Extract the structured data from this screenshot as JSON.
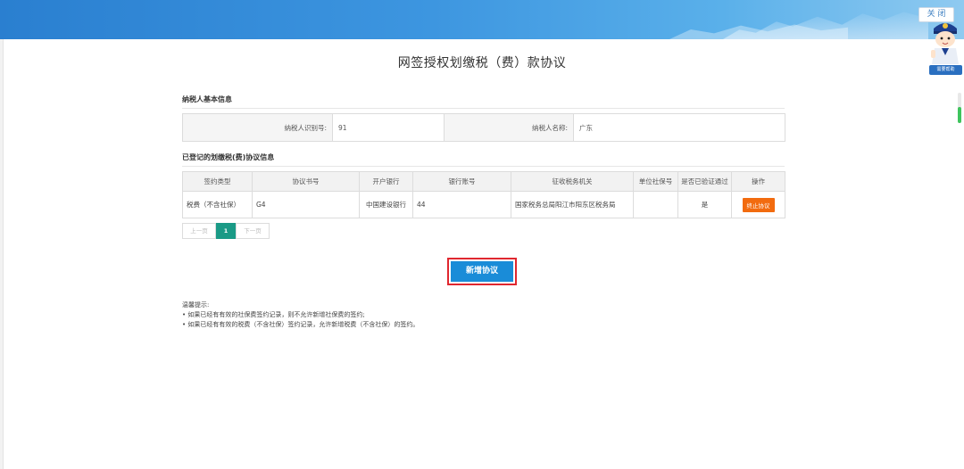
{
  "header": {
    "close_label": "关 闭",
    "mascot_badge": "需要帮助"
  },
  "page": {
    "title": "网签授权划缴税（费）款协议"
  },
  "basic_info": {
    "section_title": "纳税人基本信息",
    "taxpayer_id_label": "纳税人识别号:",
    "taxpayer_id_value": "91",
    "taxpayer_name_label": "纳税人名称:",
    "taxpayer_name_value": "广东"
  },
  "agreements": {
    "section_title": "已登记的划缴税(费)协议信息",
    "columns": [
      "签约类型",
      "协议书号",
      "开户银行",
      "银行账号",
      "征收税务机关",
      "单位社保号",
      "是否已验证通过",
      "操作"
    ],
    "rows": [
      {
        "type": "税费（不含社保）",
        "agreement_no": "G4",
        "bank": "中国建设银行",
        "account": "44",
        "tax_office": "国家税务总局阳江市阳东区税务局",
        "social_security_no": "",
        "verified": "是",
        "action": "终止协议"
      }
    ]
  },
  "pagination": {
    "prev_label": "上一页",
    "current_page": "1",
    "next_label": "下一页"
  },
  "add_button_label": "新增协议",
  "tips": {
    "title": "温馨提示:",
    "items": [
      "如果已经有有效的社保费签约记录，则不允许新增社保费的签约;",
      "如果已经有有效的税费（不含社保）签约记录，允许新增税费（不含社保）的签约。"
    ]
  },
  "colors": {
    "banner_blue": "#2a7fd0",
    "primary_button": "#1a8cd8",
    "highlight_border": "#e0272f",
    "stop_button": "#f26b0f",
    "active_page": "#1a9a86"
  }
}
